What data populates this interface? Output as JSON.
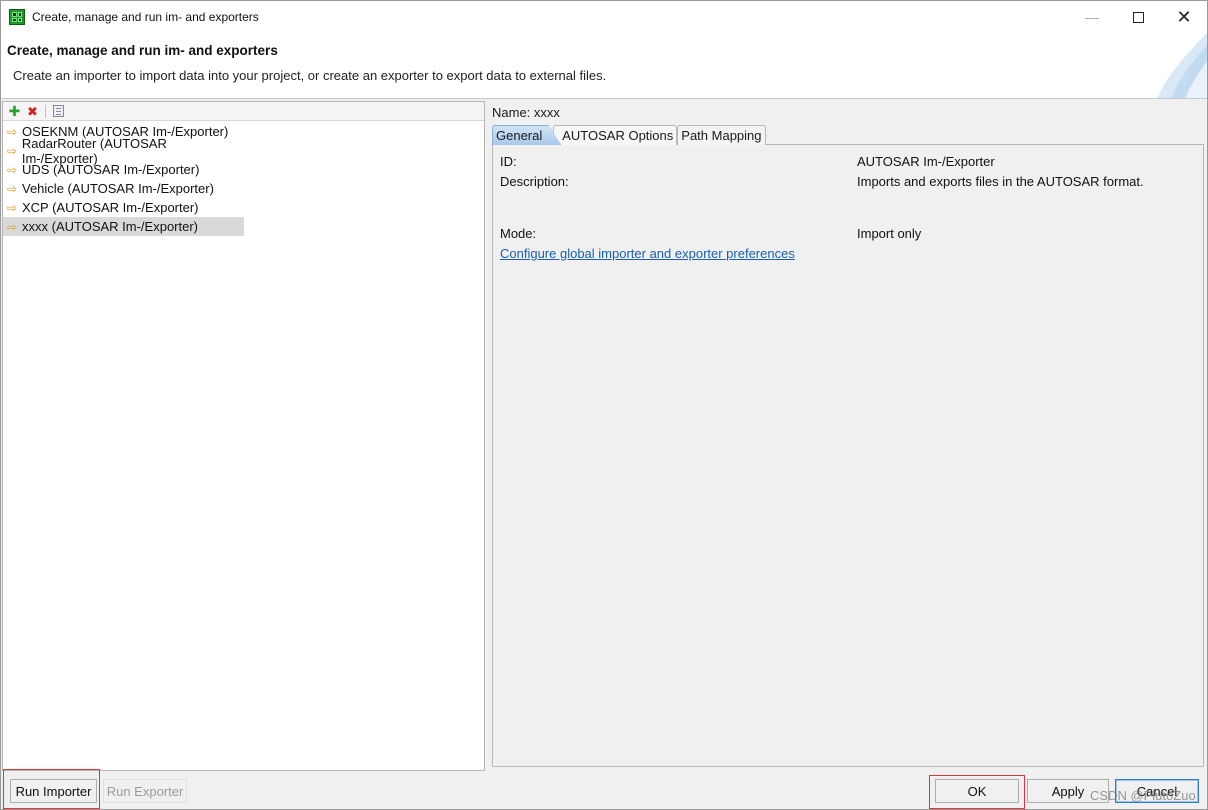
{
  "window": {
    "title": "Create, manage and run im- and exporters"
  },
  "header": {
    "title": "Create, manage and run im- and exporters",
    "description": "Create an importer to import data into your project, or create an exporter to export data to external files."
  },
  "tree": {
    "items": [
      {
        "label": "OSEKNM (AUTOSAR Im-/Exporter)"
      },
      {
        "label": "RadarRouter (AUTOSAR Im-/Exporter)"
      },
      {
        "label": "UDS (AUTOSAR Im-/Exporter)"
      },
      {
        "label": "Vehicle (AUTOSAR Im-/Exporter)"
      },
      {
        "label": "XCP (AUTOSAR Im-/Exporter)"
      },
      {
        "label": "xxxx (AUTOSAR Im-/Exporter)"
      }
    ],
    "selected_index": 5
  },
  "details": {
    "name_label": "Name:",
    "name_value": "xxxx",
    "tabs": [
      {
        "label": "General"
      },
      {
        "label": "AUTOSAR Options"
      },
      {
        "label": "Path Mapping"
      }
    ],
    "id_label": "ID:",
    "id_value": "AUTOSAR Im-/Exporter",
    "description_label": "Description:",
    "description_value": "Imports and exports files in the AUTOSAR format.",
    "mode_label": "Mode:",
    "mode_value": "Import only",
    "preferences_link": "Configure global importer and exporter preferences"
  },
  "buttons": {
    "run_importer": "Run Importer",
    "run_exporter": "Run Exporter",
    "ok": "OK",
    "apply": "Apply",
    "cancel": "Cancel"
  },
  "watermark": "CSDN @PlutoZuo",
  "colors": {
    "link": "#1a5fb4",
    "highlight_frame": "#d9363e",
    "selection": "#d9d9d9",
    "active_tab": "#a9c9ea"
  }
}
